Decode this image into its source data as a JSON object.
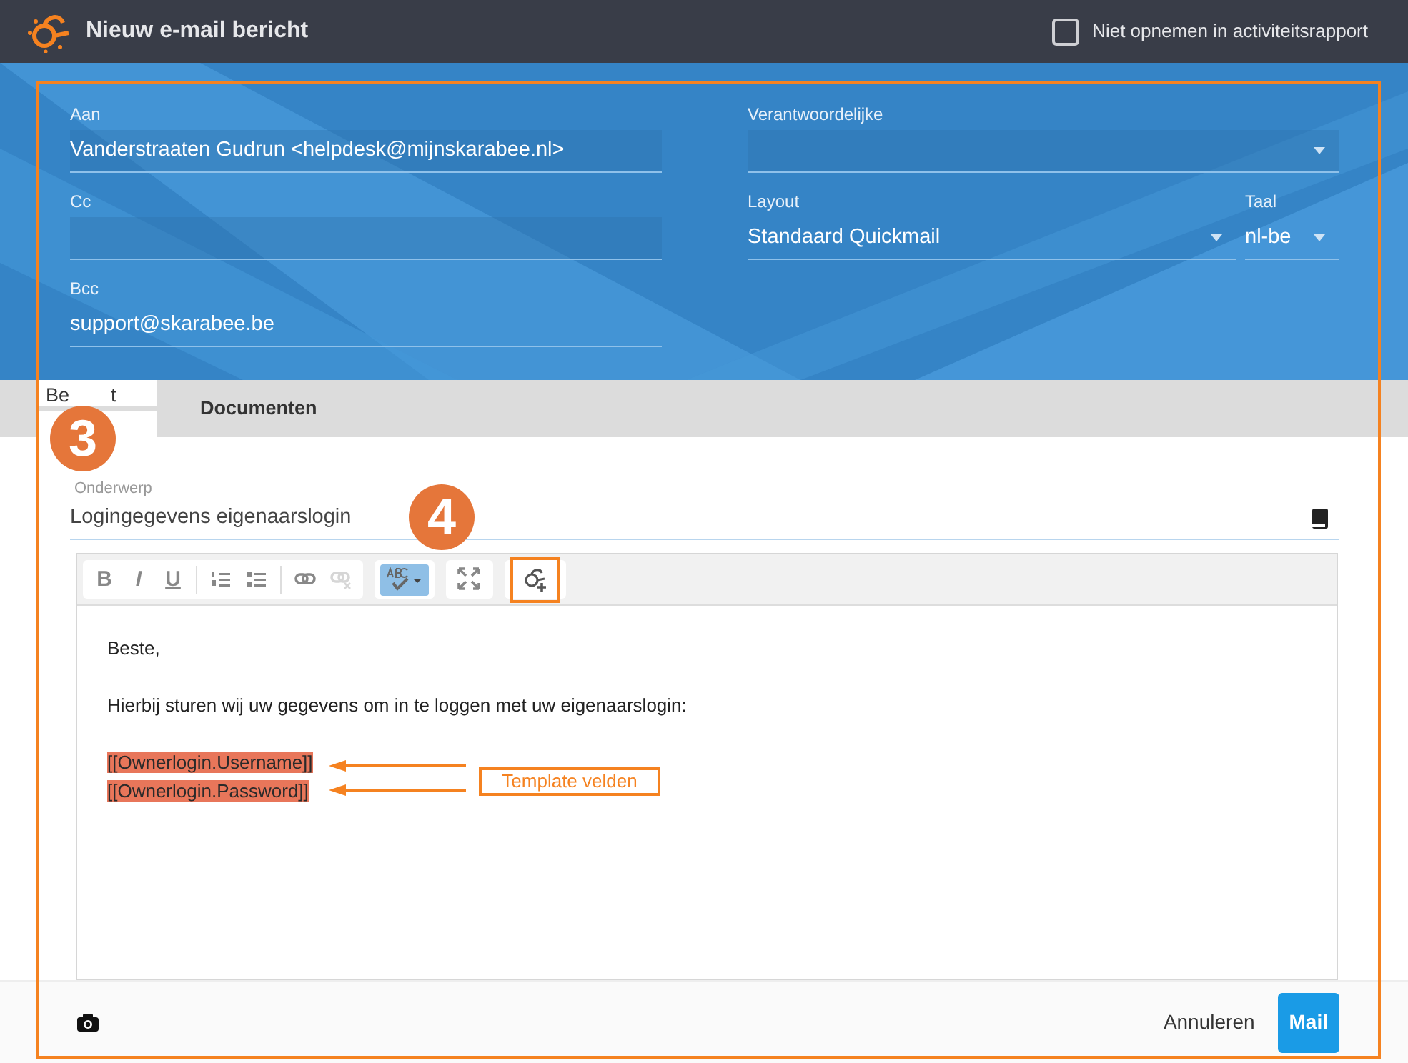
{
  "header": {
    "title": "Nieuw e-mail bericht",
    "checkbox": {
      "label": "Niet opnemen in activiteitsrapport",
      "checked": false
    }
  },
  "recipients": [
    {
      "label": "Aan",
      "value": "Vanderstraaten Gudrun <helpdesk@mijnskarabee.nl>",
      "filled": true
    },
    {
      "label": "Cc",
      "filled": true
    },
    {
      "label": "Bcc",
      "value": "support@skarabee.be",
      "filled": false
    }
  ],
  "verantwoordelijke": {
    "label": "Verantwoordelijke"
  },
  "layout": {
    "label": "Layout",
    "value": "Standaard Quickmail"
  },
  "taal": {
    "label": "Taal",
    "value": "nl-be"
  },
  "tabs": [
    {
      "label": "Be",
      "label_end": "t",
      "selected": true
    },
    {
      "label": "Documenten",
      "selected": false
    }
  ],
  "subject": {
    "label": "Onderwerp",
    "value": "Logingegevens eigenaarslogin"
  },
  "toolbar": [
    [
      {
        "kind": "bold",
        "label": "B",
        "disabled": false
      },
      {
        "kind": "italic",
        "label": "I",
        "disabled": false
      },
      {
        "kind": "underline",
        "label": "U",
        "disabled": false
      },
      {
        "kind": "ordered-list",
        "disabled": false
      },
      {
        "kind": "bullet-list",
        "disabled": false
      },
      {
        "kind": "link",
        "disabled": false
      },
      {
        "kind": "unlink",
        "disabled": true
      }
    ],
    [
      {
        "kind": "spellcheck",
        "active": true
      }
    ],
    [
      {
        "kind": "maximize",
        "active": false
      }
    ],
    [
      {
        "kind": "template",
        "active": false,
        "highlighted": true
      }
    ]
  ],
  "body": [
    {
      "kind": "text",
      "text": "Beste,"
    },
    {
      "kind": "blank"
    },
    {
      "kind": "text",
      "text": "Hierbij sturen wij uw gegevens om in te loggen met uw eigenaarslogin:"
    },
    {
      "kind": "blank"
    },
    {
      "kind": "field",
      "text": "[[Ownerlogin.Username]]"
    },
    {
      "kind": "field",
      "text": "[[Ownerlogin.Password]]"
    }
  ],
  "footer": {
    "cancel": "Annuleren",
    "submit": "Mail"
  },
  "annotations": {
    "badges": [
      {
        "label": "3"
      },
      {
        "label": "4"
      }
    ],
    "callout": "Template velden"
  }
}
